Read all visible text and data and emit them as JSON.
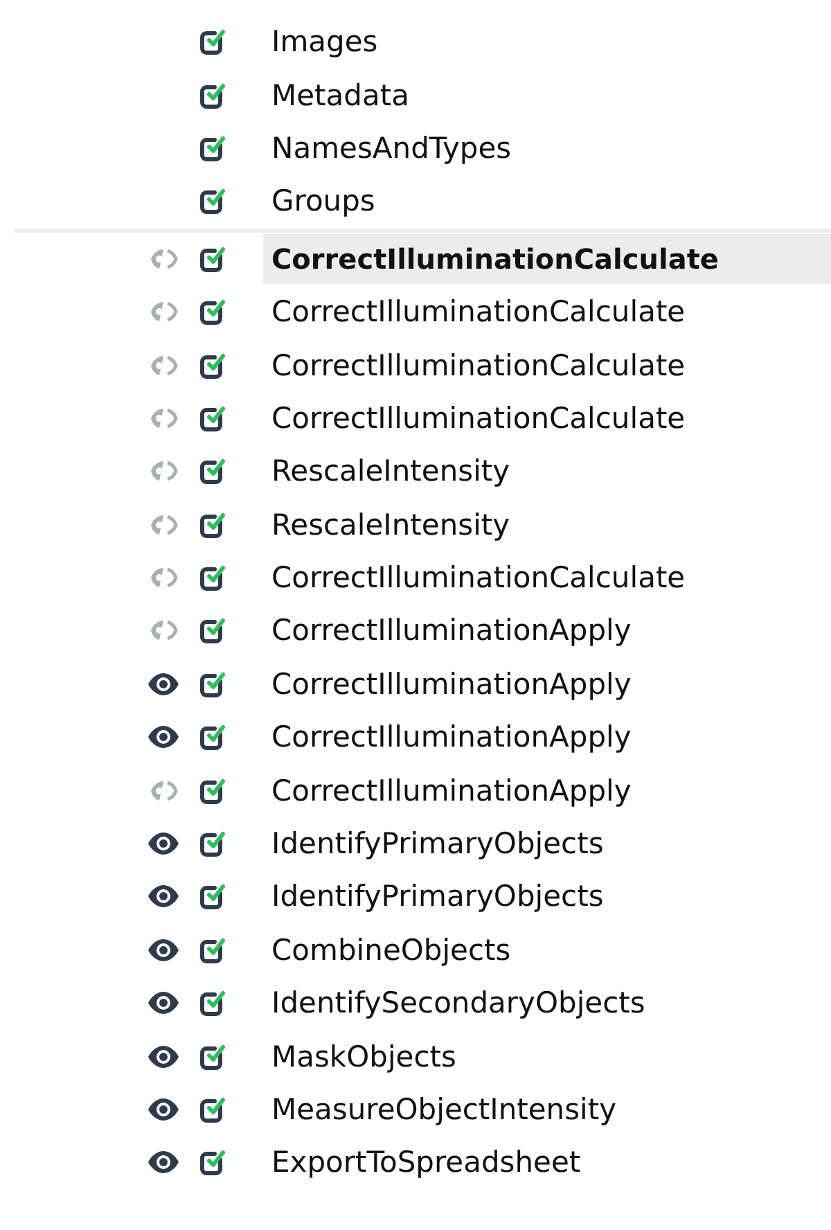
{
  "input_modules": [
    {
      "name": "Images",
      "enabled": true
    },
    {
      "name": "Metadata",
      "enabled": true
    },
    {
      "name": "NamesAndTypes",
      "enabled": true
    },
    {
      "name": "Groups",
      "enabled": true
    }
  ],
  "modules": [
    {
      "name": "CorrectIlluminationCalculate",
      "enabled": true,
      "show_window": false,
      "selected": true
    },
    {
      "name": "CorrectIlluminationCalculate",
      "enabled": true,
      "show_window": false,
      "selected": false
    },
    {
      "name": "CorrectIlluminationCalculate",
      "enabled": true,
      "show_window": false,
      "selected": false
    },
    {
      "name": "CorrectIlluminationCalculate",
      "enabled": true,
      "show_window": false,
      "selected": false
    },
    {
      "name": "RescaleIntensity",
      "enabled": true,
      "show_window": false,
      "selected": false
    },
    {
      "name": "RescaleIntensity",
      "enabled": true,
      "show_window": false,
      "selected": false
    },
    {
      "name": "CorrectIlluminationCalculate",
      "enabled": true,
      "show_window": false,
      "selected": false
    },
    {
      "name": "CorrectIlluminationApply",
      "enabled": true,
      "show_window": false,
      "selected": false
    },
    {
      "name": "CorrectIlluminationApply",
      "enabled": true,
      "show_window": true,
      "selected": false
    },
    {
      "name": "CorrectIlluminationApply",
      "enabled": true,
      "show_window": true,
      "selected": false
    },
    {
      "name": "CorrectIlluminationApply",
      "enabled": true,
      "show_window": false,
      "selected": false
    },
    {
      "name": "IdentifyPrimaryObjects",
      "enabled": true,
      "show_window": true,
      "selected": false
    },
    {
      "name": "IdentifyPrimaryObjects",
      "enabled": true,
      "show_window": true,
      "selected": false
    },
    {
      "name": "CombineObjects",
      "enabled": true,
      "show_window": true,
      "selected": false
    },
    {
      "name": "IdentifySecondaryObjects",
      "enabled": true,
      "show_window": true,
      "selected": false
    },
    {
      "name": "MaskObjects",
      "enabled": true,
      "show_window": true,
      "selected": false
    },
    {
      "name": "MeasureObjectIntensity",
      "enabled": true,
      "show_window": true,
      "selected": false
    },
    {
      "name": "ExportToSpreadsheet",
      "enabled": true,
      "show_window": true,
      "selected": false
    }
  ]
}
